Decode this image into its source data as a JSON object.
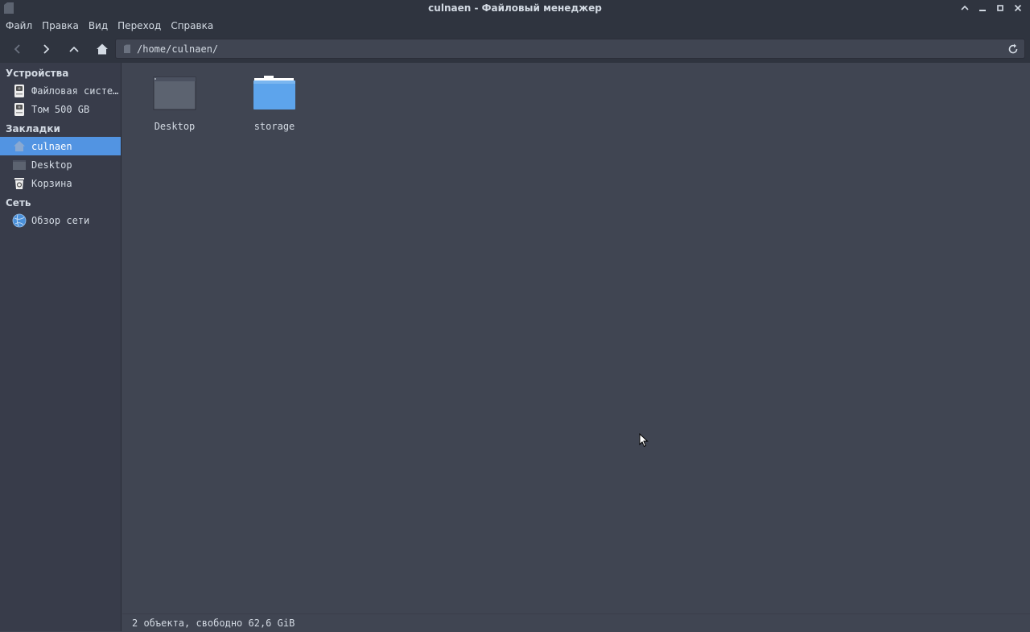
{
  "window": {
    "title": "culnaen - Файловый менеджер"
  },
  "menubar": {
    "items": [
      "Файл",
      "Правка",
      "Вид",
      "Переход",
      "Справка"
    ]
  },
  "location": {
    "path": "/home/culnaen/"
  },
  "sidebar": {
    "sections": [
      {
        "header": "Устройства",
        "items": [
          {
            "label": "Файловая систе…",
            "icon": "drive-harddisk-icon"
          },
          {
            "label": "Том 500 GB",
            "icon": "drive-harddisk-icon"
          }
        ]
      },
      {
        "header": "Закладки",
        "items": [
          {
            "label": "culnaen",
            "icon": "home-folder-icon",
            "selected": true
          },
          {
            "label": "Desktop",
            "icon": "desktop-folder-icon"
          },
          {
            "label": "Корзина",
            "icon": "trash-icon"
          }
        ]
      },
      {
        "header": "Сеть",
        "items": [
          {
            "label": "Обзор сети",
            "icon": "network-icon"
          }
        ]
      }
    ]
  },
  "files": [
    {
      "name": "Desktop",
      "icon": "desktop-folder-icon"
    },
    {
      "name": "storage",
      "icon": "folder-icon"
    }
  ],
  "status": {
    "text": "2 объекта, свободно 62,6 GiB"
  },
  "colors": {
    "accent": "#5294e2",
    "background": "#404552",
    "sidebar": "#383c4a",
    "chrome": "#2f343f"
  }
}
